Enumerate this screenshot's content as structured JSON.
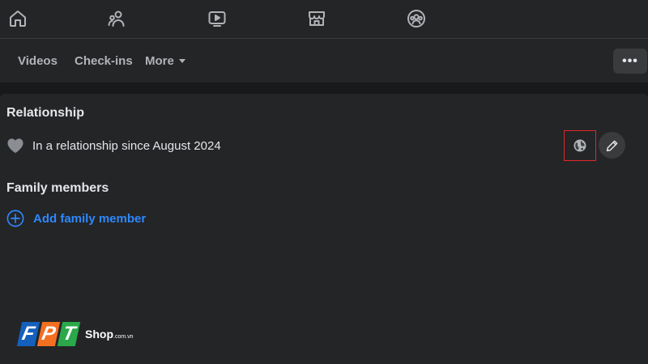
{
  "nav": {
    "icons": [
      "home-icon",
      "friends-icon",
      "watch-icon",
      "marketplace-icon",
      "groups-icon"
    ]
  },
  "tabs": {
    "videos": "Videos",
    "checkins": "Check-ins",
    "more": "More",
    "options_label": "•••"
  },
  "relationship": {
    "title": "Relationship",
    "status": "In a relationship since August 2024",
    "privacy_icon": "globe-icon",
    "highlight_color": "#e3262a"
  },
  "family": {
    "title": "Family members",
    "add_label": "Add family member"
  },
  "logo": {
    "letters": [
      "F",
      "P",
      "T"
    ],
    "shop": "Shop",
    "domain": ".com.vn",
    "colors": [
      "#1560bd",
      "#f37021",
      "#2aa84a"
    ]
  },
  "colors": {
    "background": "#18191a",
    "surface": "#242526",
    "text": "#e4e6eb",
    "secondary_text": "#b0b3b8",
    "accent": "#2d88ff"
  }
}
